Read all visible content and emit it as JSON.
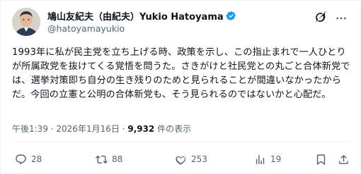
{
  "author": {
    "display_name": "鳩山友紀夫（由紀夫）Yukio Hatoyama",
    "handle": "@hatoyamayukio",
    "verified_color": "#1d9bf0"
  },
  "header_icons": [
    "grok-icon",
    "more-icon"
  ],
  "tweet": {
    "text": "1993年に私が民主党を立ち上げる時、政策を示し、この指止まれで一人ひとりが所属政党を抜けてくる覚悟を問うた。さきがけと社民党との丸ごと合体新党では、選挙対策即ち自分の生き残りのためと見られることが間違いなかったからだ。今回の立憲と公明の合体新党も、そう見られるのではないかと心配だ。"
  },
  "meta": {
    "time": "午後1:39",
    "separator": " · ",
    "date": "2026年1月16日",
    "views_count": "9,932",
    "views_label": " 件の表示"
  },
  "actions": {
    "reply_count": "28",
    "repost_count": "88",
    "like_count": "253",
    "views_count": "19"
  },
  "colors": {
    "text": "#0f1419",
    "secondary": "#536471",
    "accent": "#1d9bf0"
  }
}
